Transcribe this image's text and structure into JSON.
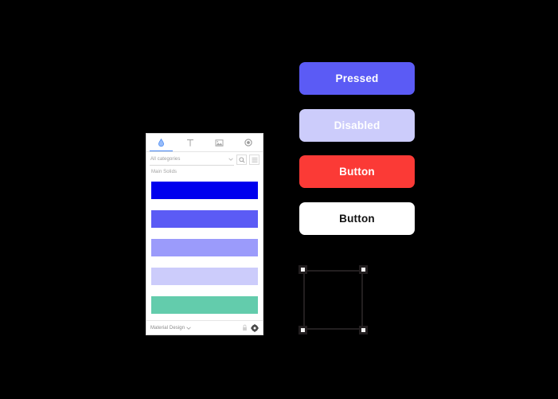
{
  "palette_panel": {
    "tabs": [
      {
        "name": "color-tab",
        "icon": "eyedropper-icon",
        "active": true
      },
      {
        "name": "text-tab",
        "icon": "text-t-icon",
        "active": false
      },
      {
        "name": "image-tab",
        "icon": "image-icon",
        "active": false
      },
      {
        "name": "effects-tab",
        "icon": "opacity-icon",
        "active": false
      }
    ],
    "search": {
      "category_value": "All categories",
      "dropdown_icon": "chevron-down-icon",
      "search_icon": "search-icon",
      "list_view_icon": "list-view-icon"
    },
    "section_label": "Main Solids",
    "swatches": [
      {
        "name": "swatch-blue",
        "color": "#0000EE"
      },
      {
        "name": "swatch-indigo",
        "color": "#5B5BF5"
      },
      {
        "name": "swatch-periwinkle",
        "color": "#9B9BFB"
      },
      {
        "name": "swatch-lavender",
        "color": "#CCCCFB"
      },
      {
        "name": "swatch-teal",
        "color": "#63CCAC"
      }
    ],
    "footer": {
      "theme_label": "Material Design",
      "theme_chevron_icon": "chevron-down-icon",
      "lock_icon": "lock-icon",
      "settings_icon": "gear-icon"
    }
  },
  "buttons": [
    {
      "name": "pressed-button",
      "label": "Pressed",
      "bg": "#5B5BF5",
      "fg": "#FFFFFF"
    },
    {
      "name": "disabled-button",
      "label": "Disabled",
      "bg": "#CCCCFB",
      "fg": "#FFFFFF"
    },
    {
      "name": "danger-button",
      "label": "Button",
      "bg": "#FB3A36",
      "fg": "#FFFFFF"
    },
    {
      "name": "default-button",
      "label": "Button",
      "bg": "#FFFFFF",
      "fg": "#111111"
    }
  ],
  "selection": {
    "handle_count": 4,
    "stroke_color": "#231F20",
    "handle_fill": "#F4F4F4"
  },
  "canvas": {
    "background": "#000000"
  }
}
